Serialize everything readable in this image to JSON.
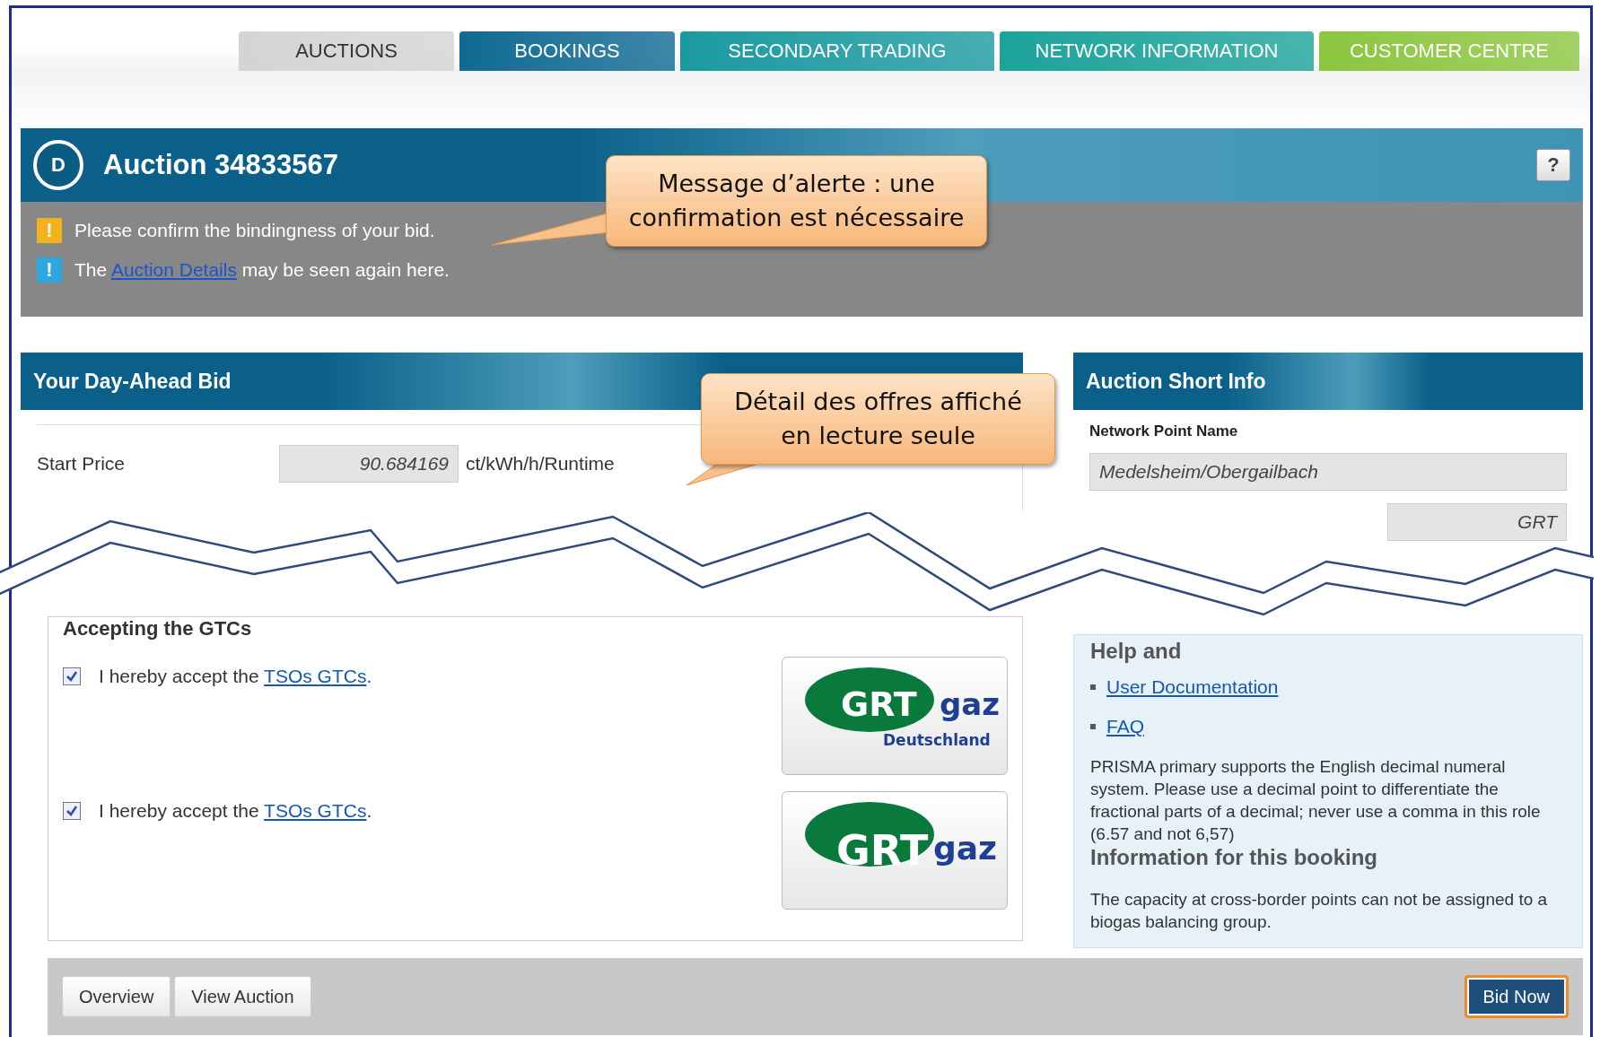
{
  "tabs": [
    {
      "label": "AUCTIONS",
      "color": "#d4d4d4"
    },
    {
      "label": "BOOKINGS",
      "color": "#0f6a93"
    },
    {
      "label": "SECONDARY TRADING",
      "color": "#1a9aa0"
    },
    {
      "label": "NETWORK INFORMATION",
      "color": "#1ba39a"
    },
    {
      "label": "CUSTOMER CENTRE",
      "color": "#8cc63f"
    }
  ],
  "auction": {
    "badge": "D",
    "title": "Auction 34833567",
    "help": "?"
  },
  "alerts": [
    {
      "kind": "warning",
      "icon": "!",
      "text_before": "Please confirm the bindingness of your bid."
    },
    {
      "kind": "info",
      "icon": "!",
      "text_before": "The",
      "link": "Auction Details",
      "text_after": "may be seen again here."
    }
  ],
  "bid_panel": {
    "title": "Your Day-Ahead Bid",
    "start_price": {
      "label": "Start Price",
      "value": "90.684169",
      "unit": "ct/kWh/h/Runtime"
    },
    "gtc_title": "Accepting the GTCs",
    "gtcs": [
      {
        "text_before": "I hereby accept the",
        "link": "TSOs GTCs",
        "text_after": ".",
        "checked": true,
        "logo": {
          "brand": "GRT",
          "suffix": "gaz",
          "subtitle": "Deutschland"
        }
      },
      {
        "text_before": "I hereby accept the",
        "link": "TSOs GTCs",
        "text_after": ".",
        "checked": true,
        "logo": {
          "brand": "GRT",
          "suffix": "gaz"
        }
      }
    ]
  },
  "info_panel": {
    "title": "Auction Short Info",
    "network_point_label": "Network Point Name",
    "network_point": "Medelsheim/Obergailbach",
    "field_2": "GRT",
    "help_title": "Help and",
    "links": [
      "User Documentation",
      "FAQ"
    ],
    "note": "PRISMA primary supports the English decimal numeral system. Please use a decimal point to differentiate the fractional parts of a decimal; never use a comma in this role (6.57 and not 6,57)",
    "booking_title": "Information for this booking",
    "booking_note": "The capacity at cross-border points can not be assigned to a biogas balancing group."
  },
  "footer": {
    "buttons": [
      "Overview",
      "View Auction"
    ],
    "primary": {
      "label": "Bid Now",
      "highlighted": true
    }
  },
  "callouts": [
    {
      "text": "Message d’alerte : une confirmation est nécessaire"
    },
    {
      "text": "Détail des offres affiché en lecture seule"
    }
  ]
}
